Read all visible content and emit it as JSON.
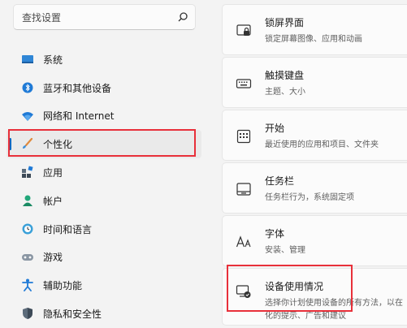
{
  "search": {
    "placeholder": "查找设置",
    "icon": "search-icon"
  },
  "sidebar": {
    "items": [
      {
        "label": "系统",
        "icon": "monitor-icon"
      },
      {
        "label": "蓝牙和其他设备",
        "icon": "bluetooth-icon"
      },
      {
        "label": "网络和 Internet",
        "icon": "wifi-icon"
      },
      {
        "label": "个性化",
        "icon": "brush-icon",
        "active": true
      },
      {
        "label": "应用",
        "icon": "apps-icon"
      },
      {
        "label": "帐户",
        "icon": "account-icon"
      },
      {
        "label": "时间和语言",
        "icon": "globe-clock-icon"
      },
      {
        "label": "游戏",
        "icon": "gamepad-icon"
      },
      {
        "label": "辅助功能",
        "icon": "accessibility-icon"
      },
      {
        "label": "隐私和安全性",
        "icon": "shield-icon"
      }
    ]
  },
  "cards": [
    {
      "title": "锁屏界面",
      "subtitle": "锁定屏幕图像、应用和动画",
      "icon": "lock-screen-icon"
    },
    {
      "title": "触摸键盘",
      "subtitle": "主题、大小",
      "icon": "keyboard-icon"
    },
    {
      "title": "开始",
      "subtitle": "最近使用的应用和项目、文件夹",
      "icon": "start-menu-icon"
    },
    {
      "title": "任务栏",
      "subtitle": "任务栏行为，系统固定项",
      "icon": "taskbar-icon"
    },
    {
      "title": "字体",
      "subtitle": "安装、管理",
      "icon": "font-icon"
    },
    {
      "title": "设备使用情况",
      "subtitle": "选择你计划使用设备的所有方法，以在",
      "subtitle2": "化的提示、广告和建议",
      "icon": "device-usage-icon"
    }
  ],
  "colors": {
    "accent": "#0067c0",
    "highlight": "#e8303a"
  }
}
